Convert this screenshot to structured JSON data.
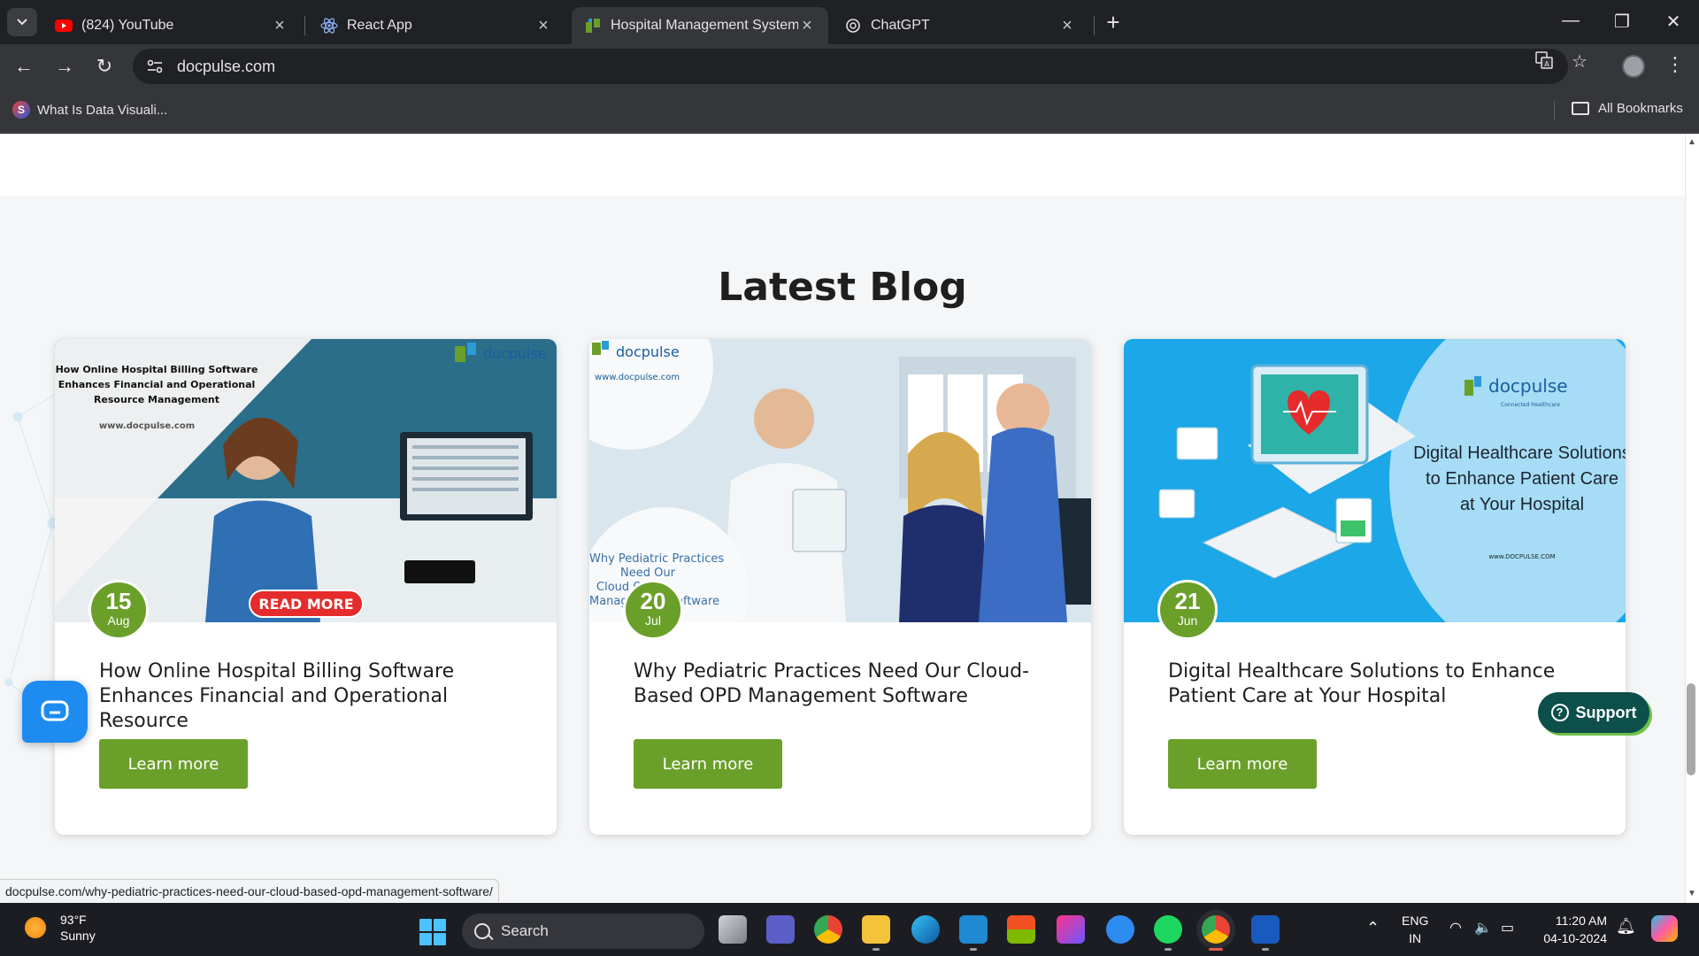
{
  "browser": {
    "tabs": [
      {
        "title": "(824) YouTube",
        "icon": "youtube-icon",
        "active": false
      },
      {
        "title": "React App",
        "icon": "react-icon",
        "active": false
      },
      {
        "title": "Hospital Management System |",
        "icon": "docpulse-icon",
        "active": true
      },
      {
        "title": "ChatGPT",
        "icon": "chatgpt-icon",
        "active": false
      }
    ],
    "url": "docpulse.com",
    "bookmark": "What Is Data Visuali...",
    "all_bookmarks": "All Bookmarks"
  },
  "page": {
    "heading": "Latest Blog",
    "cards": [
      {
        "day": "15",
        "month": "Aug",
        "title": "How Online Hospital Billing Software Enhances Financial and Operational Resource",
        "button": "Learn more",
        "image_title": "How Online Hospital Billing Software Enhances Financial and Operational Resource Management",
        "image_url": "www.docpulse.com",
        "image_badge": "READ MORE",
        "image_brand": "docpulse"
      },
      {
        "day": "20",
        "month": "Jul",
        "title": "Why Pediatric Practices Need Our Cloud-Based OPD Management Software",
        "button": "Learn more",
        "image_brand": "docpulse",
        "image_url": "www.docpulse.com",
        "image_caption": "Why Pediatric Practices Need Our Cloud OPD Management Software"
      },
      {
        "day": "21",
        "month": "Jun",
        "title": "Digital Healthcare Solutions to Enhance Patient Care at Your Hospital",
        "button": "Learn more",
        "image_brand": "docpulse",
        "image_tagline": "Connected Healthcare",
        "image_title": "Digital Healthcare Solutions to Enhance Patient Care at Your Hospital",
        "image_url": "www.DOCPULSE.COM"
      }
    ],
    "support_label": "Support",
    "status_url": "docpulse.com/why-pediatric-practices-need-our-cloud-based-opd-management-software/"
  },
  "taskbar": {
    "temperature": "93°F",
    "condition": "Sunny",
    "search_placeholder": "Search",
    "lang": "ENG",
    "region": "IN",
    "time": "11:20 AM",
    "date": "04-10-2024"
  },
  "colors": {
    "accent_green": "#6a9f2a",
    "support_teal": "#0d4f4a",
    "chat_blue": "#1e8bf0"
  }
}
